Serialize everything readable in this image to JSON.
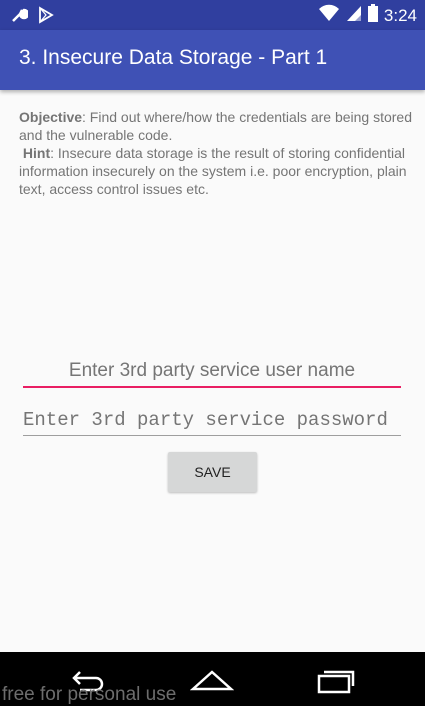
{
  "status_bar": {
    "time": "3:24",
    "icons": [
      "wrench-icon",
      "play-store-icon",
      "wifi-icon",
      "signal-icon",
      "battery-icon"
    ],
    "color": "#303f9f"
  },
  "app_bar": {
    "title": "3. Insecure Data Storage - Part 1",
    "color": "#3f51b5"
  },
  "content": {
    "objective_label": "Objective",
    "objective_text": ": Find out where/how the credentials are being stored and the vulnerable code.",
    "hint_label": "Hint",
    "hint_text": ": Insecure data storage is the result of storing confidential information insecurely on the system i.e. poor encryption, plain text, access control issues etc."
  },
  "form": {
    "username_placeholder": "Enter 3rd party service user name",
    "username_value": "",
    "password_placeholder": "Enter 3rd party service password",
    "password_value": "",
    "save_label": "SAVE",
    "accent_color": "#e91e63"
  },
  "nav_bar": {
    "icons": [
      "back-icon",
      "home-icon",
      "recents-icon"
    ]
  },
  "watermark": "free for personal use"
}
